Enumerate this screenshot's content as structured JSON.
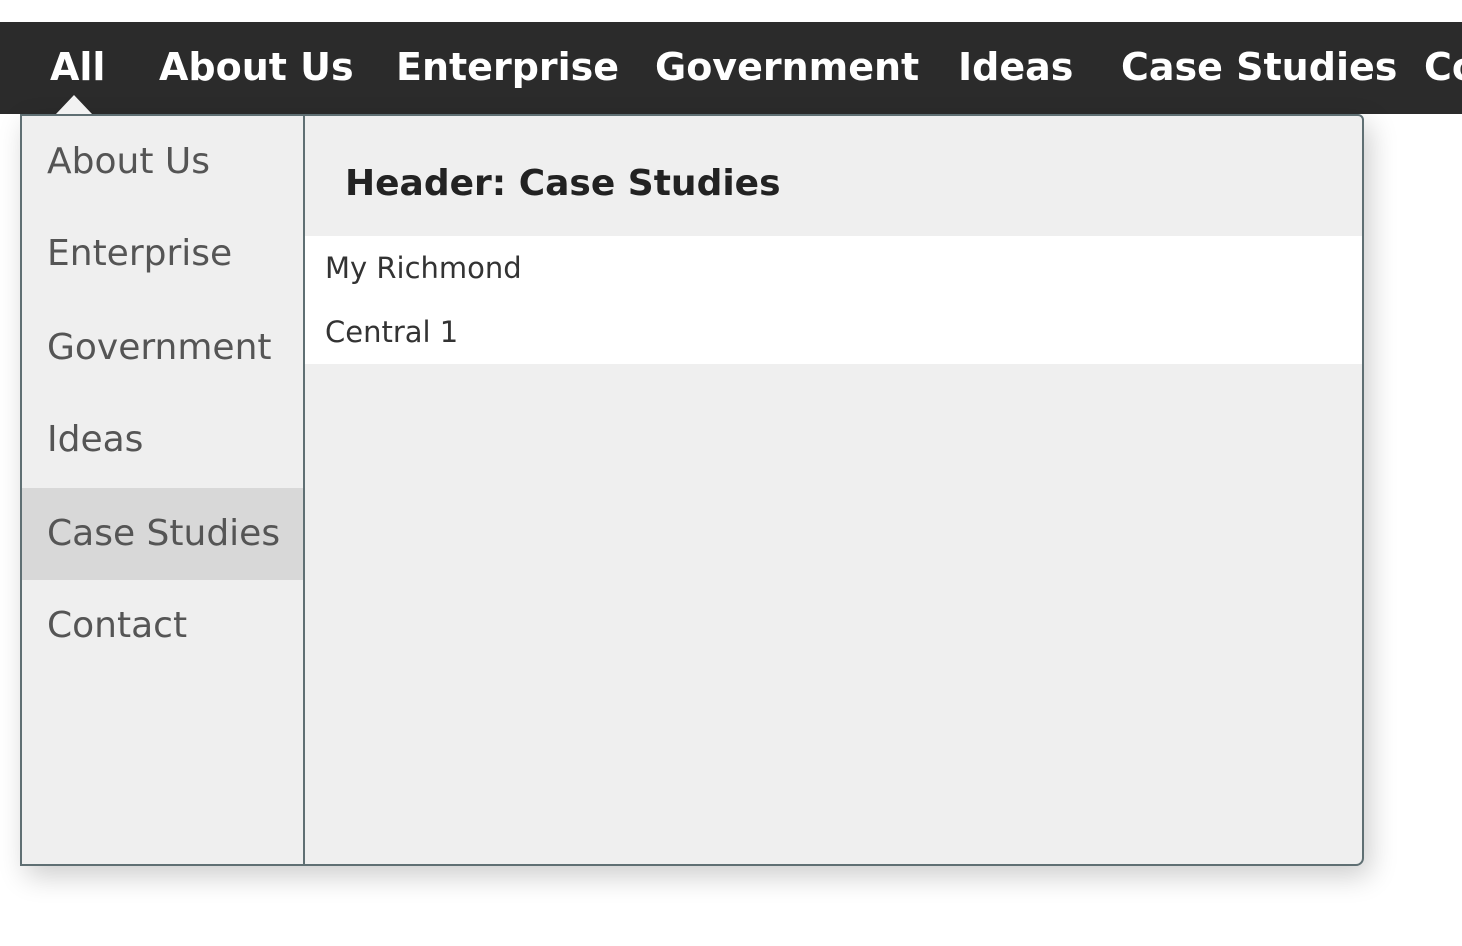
{
  "topnav": {
    "items": [
      "All",
      "About Us",
      "Enterprise",
      "Government",
      "Ideas",
      "Case Studies",
      "Co"
    ]
  },
  "dropdown": {
    "sidebar": {
      "items": [
        "About Us",
        "Enterprise",
        "Government",
        "Ideas",
        "Case Studies",
        "Contact"
      ],
      "active": "Case Studies"
    },
    "panel": {
      "header": "Header: Case Studies",
      "links": [
        "My Richmond",
        "Central 1"
      ]
    }
  },
  "colors": {
    "nav_background": "#2b2b2b",
    "nav_text": "#ffffff",
    "dropdown_background": "#efefef",
    "active_item_background": "#d8d8d8",
    "border": "#5f6f73"
  }
}
